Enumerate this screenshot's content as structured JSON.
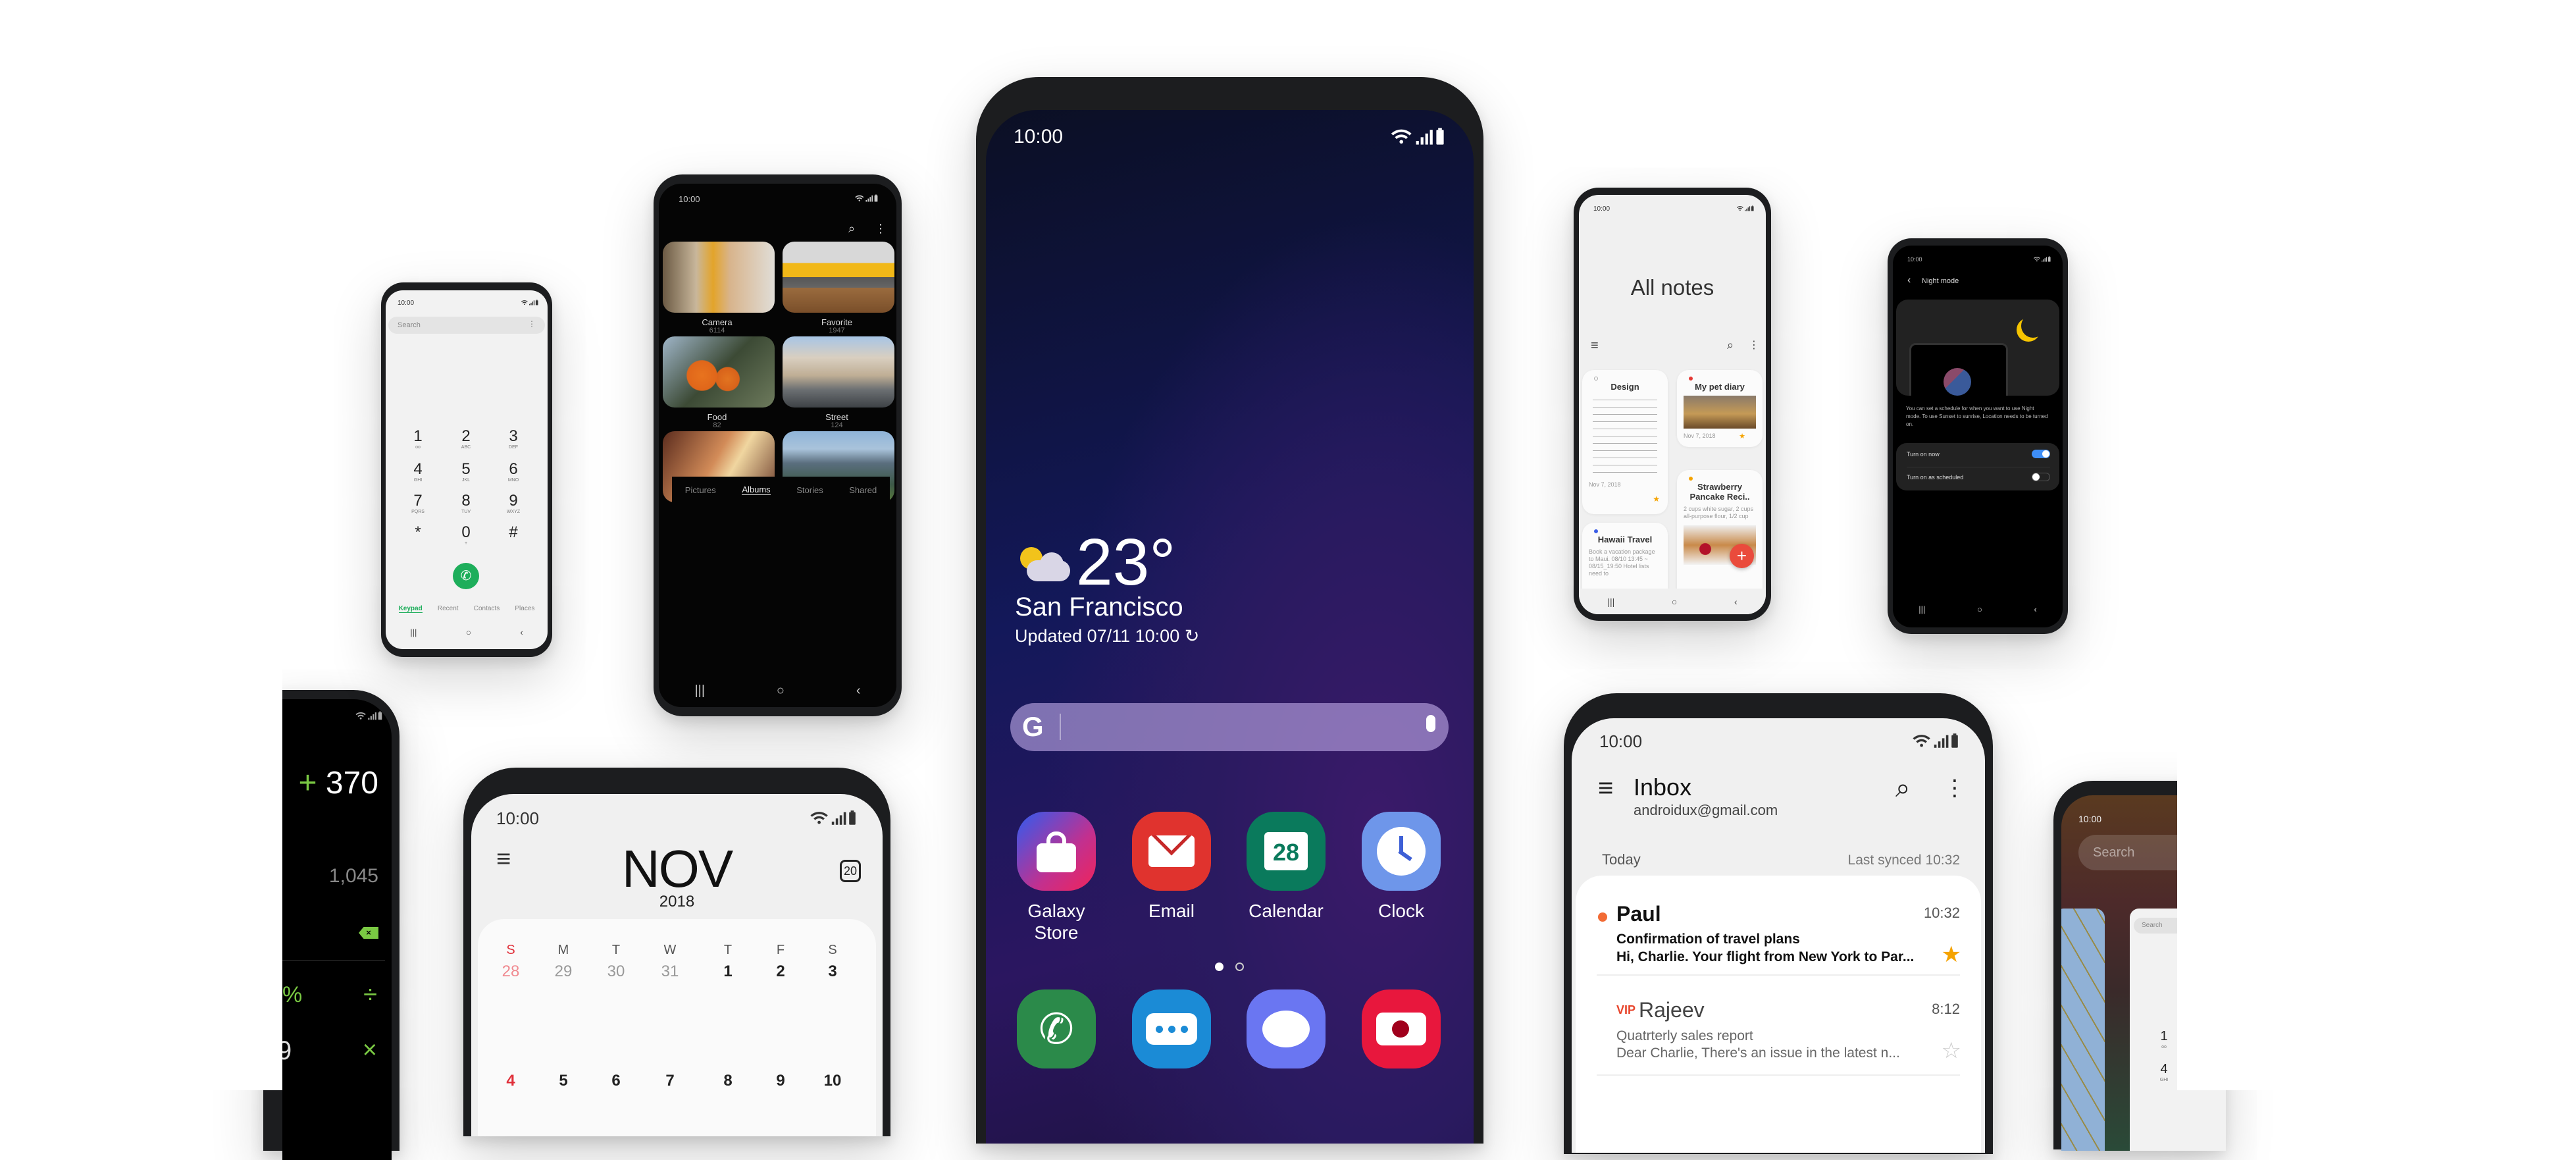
{
  "center_phone": {
    "status_time": "10:00",
    "weather": {
      "icon": "partly-sunny-icon",
      "temperature": "23°",
      "city": "San Francisco",
      "updated": "Updated 07/11 10:00"
    },
    "search_bar": {
      "logo": "G",
      "value": ""
    },
    "apps": [
      {
        "label": "Galaxy Store",
        "icon": "shopping-bag-icon",
        "color": "#c2308f"
      },
      {
        "label": "Email",
        "icon": "envelope-icon",
        "color": "#e0332e"
      },
      {
        "label": "Calendar",
        "icon": "calendar-icon",
        "badge": "28",
        "color": "#0a7a5c"
      },
      {
        "label": "Clock",
        "icon": "clock-icon",
        "color": "#6e96ea"
      }
    ],
    "page_indicator": {
      "pages": 2,
      "current": 1
    },
    "dock": [
      {
        "icon": "phone-icon",
        "color": "#2b8a4a"
      },
      {
        "icon": "messages-icon",
        "color": "#1b8bd6"
      },
      {
        "icon": "bixby-icon",
        "color": "#6a76f2"
      },
      {
        "icon": "camera-icon",
        "color": "#e8173d"
      }
    ]
  },
  "gallery_phone": {
    "status_time": "10:00",
    "albums": [
      {
        "name": "Camera",
        "count": "6114"
      },
      {
        "name": "Favorite",
        "count": "1947"
      },
      {
        "name": "Food",
        "count": "82"
      },
      {
        "name": "Street",
        "count": "124"
      },
      {
        "name": "",
        "count": ""
      },
      {
        "name": "",
        "count": ""
      }
    ],
    "tabs": [
      "Pictures",
      "Albums",
      "Stories",
      "Shared"
    ],
    "active_tab": "Albums"
  },
  "dialer_phone": {
    "status_time": "10:00",
    "search_placeholder": "Search",
    "keys": [
      {
        "digit": "1",
        "letters": "oo"
      },
      {
        "digit": "2",
        "letters": "ABC"
      },
      {
        "digit": "3",
        "letters": "DEF"
      },
      {
        "digit": "4",
        "letters": "GHI"
      },
      {
        "digit": "5",
        "letters": "JKL"
      },
      {
        "digit": "6",
        "letters": "MNO"
      },
      {
        "digit": "7",
        "letters": "PQRS"
      },
      {
        "digit": "8",
        "letters": "TUV"
      },
      {
        "digit": "9",
        "letters": "WXYZ"
      },
      {
        "digit": "*",
        "letters": ""
      },
      {
        "digit": "0",
        "letters": "+"
      },
      {
        "digit": "#",
        "letters": ""
      }
    ],
    "tabs": [
      "Keypad",
      "Recent",
      "Contacts",
      "Places"
    ],
    "active_tab": "Keypad",
    "accent": "#1eae5b"
  },
  "notes_phone": {
    "status_time": "10:00",
    "title": "All notes",
    "notes": [
      {
        "title": "Design",
        "date": "Nov 7, 2018",
        "starred": true
      },
      {
        "title": "My pet diary",
        "date": "Nov 7, 2018",
        "starred": true
      },
      {
        "title": "Hawaii Travel",
        "body": "Book a vacation package to Maui. 08/10 13:45 ~ 08/15_19:50 Hotel lists need to"
      },
      {
        "title": "Strawberry Pancake Reci..",
        "body": "2 cups white sugar, 2 cups all-purpose flour, 1/2 cup"
      }
    ],
    "fab": "+"
  },
  "night_phone": {
    "status_time": "10:00",
    "title": "Night mode",
    "description": "You can set a schedule for when you want to use Night mode. To use Sunset to sunrise, Location needs to be turned on.",
    "toggles": [
      {
        "label": "Turn on now",
        "on": true
      },
      {
        "label": "Turn on as scheduled",
        "on": false
      }
    ],
    "accent": "#3e8ef7"
  },
  "calculator_phone": {
    "expression_operator": "+",
    "expression_value": "370",
    "result": "1,045",
    "keys": [
      "%",
      "÷",
      "9",
      "×"
    ],
    "accent": "#7ac943"
  },
  "calendar_phone": {
    "status_time": "10:00",
    "month": "NOV",
    "year": "2018",
    "today_badge": "20",
    "weekdays": [
      "S",
      "M",
      "T",
      "W",
      "T",
      "F",
      "S"
    ],
    "weeks": [
      [
        "28",
        "29",
        "30",
        "31",
        "1",
        "2",
        "3"
      ],
      [
        "4",
        "5",
        "6",
        "7",
        "8",
        "9",
        "10"
      ]
    ]
  },
  "email_phone": {
    "status_time": "10:00",
    "title": "Inbox",
    "account": "androidux@gmail.com",
    "section": "Today",
    "last_synced": "Last synced 10:32",
    "messages": [
      {
        "sender": "Paul",
        "time": "10:32",
        "subject": "Confirmation of travel plans",
        "preview": "Hi, Charlie. Your flight from New York to Par...",
        "unread": true,
        "starred": true
      },
      {
        "sender": "Rajeev",
        "vip": "VIP",
        "time": "8:12",
        "subject": "Quatrterly sales report",
        "preview": "Dear Charlie, There's an issue in the latest n...",
        "unread": false,
        "starred": false
      }
    ]
  },
  "recents_phone": {
    "status_time": "10:00",
    "search_placeholder": "Search",
    "card_search_placeholder": "Search",
    "card_keys": [
      {
        "digit": "1",
        "letters": "oo"
      },
      {
        "digit": "4",
        "letters": "GHI"
      }
    ]
  }
}
